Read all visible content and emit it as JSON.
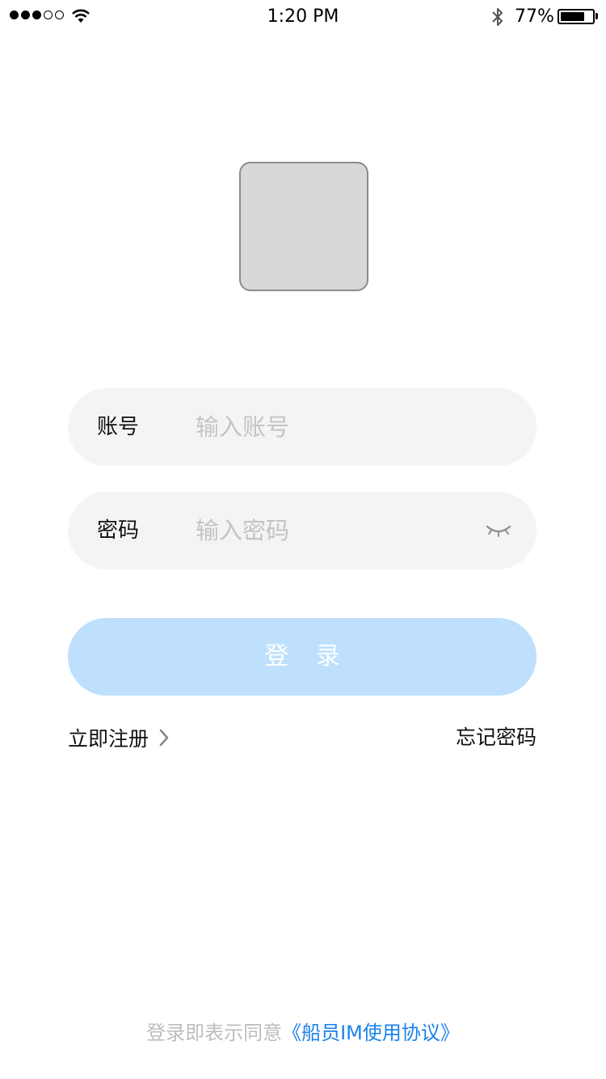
{
  "status_bar": {
    "time": "1:20 PM",
    "battery_percent": "77%",
    "battery_level": 0.77,
    "signal_bars_filled": 3,
    "signal_bars_total": 5,
    "icons": [
      "signal-dots-icon",
      "wifi-icon",
      "bluetooth-icon",
      "battery-icon"
    ]
  },
  "logo": {
    "color": "#d8d8d8",
    "border_color": "#8c8c8c"
  },
  "form": {
    "account": {
      "label": "账号",
      "placeholder": "输入账号",
      "value": ""
    },
    "password": {
      "label": "密码",
      "placeholder": "输入密码",
      "value": "",
      "toggle_icon": "eye-closed-icon"
    },
    "login_button": {
      "label": "登 录",
      "color": "#bee0fd"
    }
  },
  "links": {
    "register": "立即注册",
    "register_icon": "chevron-right-icon",
    "forgot_password": "忘记密码"
  },
  "agreement": {
    "prefix": "登录即表示同意",
    "link": "《船员IM使用协议》",
    "link_color": "#1b82ea"
  }
}
